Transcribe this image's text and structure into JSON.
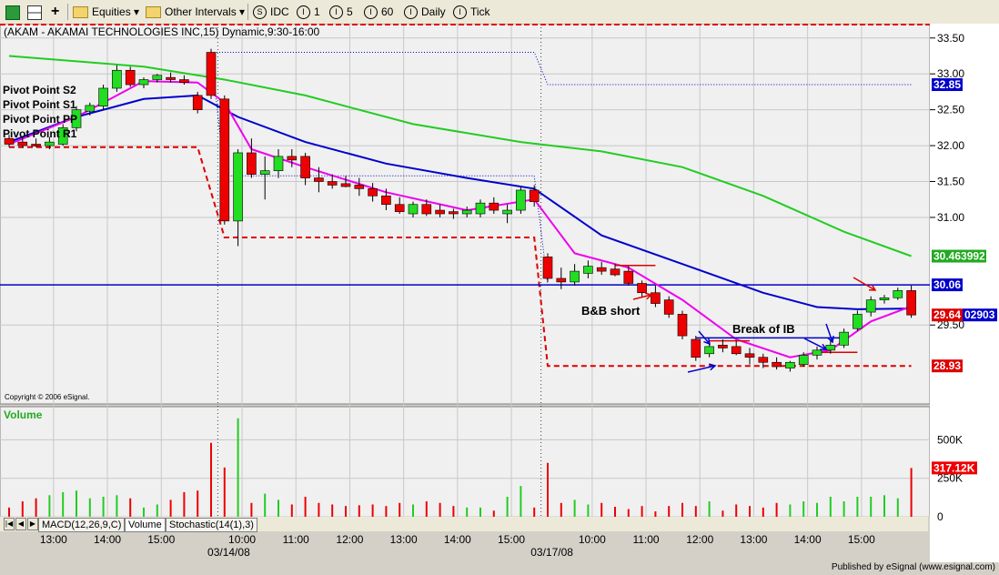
{
  "toolbar": {
    "equities_label": "Equities",
    "intervals_label": "Other Intervals",
    "idc_label": "IDC",
    "i1_label": "1",
    "i5_label": "5",
    "i60_label": "60",
    "daily_label": "Daily",
    "tick_label": "Tick",
    "colors": {
      "bg": "#ece9d8"
    }
  },
  "chart_header": "(AKAM - AKAMAI TECHNOLOGIES INC,15) Dynamic,9:30-16:00",
  "copyright": "Copyright © 2006 eSignal.",
  "published_by": "Published by eSignal (www.esignal.com)",
  "pivot_labels": [
    "Pivot Point S2",
    "Pivot Point S1",
    "Pivot Point PP",
    "Pivot Point R1"
  ],
  "annotations": {
    "bb_short": "B&B short",
    "break_ib": "Break of IB"
  },
  "volume_label": "Volume",
  "tabs": [
    "MACD(12,26,9,C)",
    "Volume",
    "Stochastic(14(1),3)"
  ],
  "chart_data": {
    "type": "candlestick",
    "symbol": "AKAM",
    "interval": "15",
    "price_axis": {
      "ylim": [
        28.4,
        33.7
      ],
      "ticks": [
        "33.50",
        "33.00",
        "32.50",
        "32.00",
        "31.50",
        "31.00",
        "29.50"
      ]
    },
    "price_labels": [
      {
        "text": "32.85",
        "value": 32.85,
        "color": "#0000cc"
      },
      {
        "text": "30.463992",
        "value": 30.46,
        "color": "#22aa22"
      },
      {
        "text": "30.06",
        "value": 30.06,
        "color": "#0000cc"
      },
      {
        "text": "29.64",
        "value": 29.64,
        "color": "#dd0000"
      },
      {
        "text": "02903",
        "value": 29.64,
        "color": "#0000cc"
      },
      {
        "text": "28.93",
        "value": 28.93,
        "color": "#dd0000"
      }
    ],
    "volume_axis": {
      "ylim": [
        0,
        650
      ],
      "ticks": [
        "500K",
        "250K",
        "0"
      ],
      "last_label": "317.12K"
    },
    "x_ticks": [
      "13:00",
      "14:00",
      "15:00",
      "10:00",
      "11:00",
      "12:00",
      "13:00",
      "14:00",
      "15:00",
      "10:00",
      "11:00",
      "12:00",
      "13:00",
      "14:00",
      "15:00"
    ],
    "date_labels": [
      "03/14/08",
      "03/17/08"
    ],
    "candles": [
      {
        "o": 32.1,
        "h": 32.15,
        "l": 31.98,
        "c": 32.02
      },
      {
        "o": 32.05,
        "h": 32.12,
        "l": 31.97,
        "c": 32.0
      },
      {
        "o": 32.02,
        "h": 32.1,
        "l": 31.98,
        "c": 32.0
      },
      {
        "o": 32.0,
        "h": 32.12,
        "l": 31.95,
        "c": 32.05
      },
      {
        "o": 32.02,
        "h": 32.3,
        "l": 32.0,
        "c": 32.25
      },
      {
        "o": 32.25,
        "h": 32.55,
        "l": 32.2,
        "c": 32.5
      },
      {
        "o": 32.48,
        "h": 32.6,
        "l": 32.42,
        "c": 32.56
      },
      {
        "o": 32.55,
        "h": 32.85,
        "l": 32.5,
        "c": 32.8
      },
      {
        "o": 32.8,
        "h": 33.12,
        "l": 32.75,
        "c": 33.05
      },
      {
        "o": 33.05,
        "h": 33.1,
        "l": 32.82,
        "c": 32.85
      },
      {
        "o": 32.85,
        "h": 32.95,
        "l": 32.8,
        "c": 32.92
      },
      {
        "o": 32.92,
        "h": 33.0,
        "l": 32.88,
        "c": 32.98
      },
      {
        "o": 32.95,
        "h": 33.02,
        "l": 32.88,
        "c": 32.92
      },
      {
        "o": 32.92,
        "h": 32.98,
        "l": 32.85,
        "c": 32.88
      },
      {
        "o": 32.7,
        "h": 32.75,
        "l": 32.45,
        "c": 32.5
      },
      {
        "o": 33.3,
        "h": 33.35,
        "l": 32.65,
        "c": 32.7
      },
      {
        "o": 32.65,
        "h": 32.7,
        "l": 30.9,
        "c": 30.95
      },
      {
        "o": 30.95,
        "h": 31.95,
        "l": 30.6,
        "c": 31.9
      },
      {
        "o": 31.9,
        "h": 32.1,
        "l": 31.55,
        "c": 31.6
      },
      {
        "o": 31.6,
        "h": 31.85,
        "l": 31.25,
        "c": 31.65
      },
      {
        "o": 31.65,
        "h": 31.95,
        "l": 31.55,
        "c": 31.85
      },
      {
        "o": 31.85,
        "h": 31.95,
        "l": 31.7,
        "c": 31.8
      },
      {
        "o": 31.85,
        "h": 31.9,
        "l": 31.45,
        "c": 31.55
      },
      {
        "o": 31.55,
        "h": 31.7,
        "l": 31.35,
        "c": 31.5
      },
      {
        "o": 31.5,
        "h": 31.6,
        "l": 31.4,
        "c": 31.45
      },
      {
        "o": 31.47,
        "h": 31.58,
        "l": 31.42,
        "c": 31.43
      },
      {
        "o": 31.45,
        "h": 31.55,
        "l": 31.3,
        "c": 31.4
      },
      {
        "o": 31.4,
        "h": 31.48,
        "l": 31.22,
        "c": 31.3
      },
      {
        "o": 31.3,
        "h": 31.4,
        "l": 31.1,
        "c": 31.18
      },
      {
        "o": 31.18,
        "h": 31.28,
        "l": 31.05,
        "c": 31.08
      },
      {
        "o": 31.05,
        "h": 31.22,
        "l": 31.0,
        "c": 31.18
      },
      {
        "o": 31.18,
        "h": 31.25,
        "l": 31.02,
        "c": 31.05
      },
      {
        "o": 31.1,
        "h": 31.18,
        "l": 31.0,
        "c": 31.05
      },
      {
        "o": 31.08,
        "h": 31.12,
        "l": 30.98,
        "c": 31.05
      },
      {
        "o": 31.05,
        "h": 31.15,
        "l": 31.0,
        "c": 31.1
      },
      {
        "o": 31.05,
        "h": 31.25,
        "l": 31.0,
        "c": 31.2
      },
      {
        "o": 31.2,
        "h": 31.28,
        "l": 31.05,
        "c": 31.1
      },
      {
        "o": 31.05,
        "h": 31.18,
        "l": 30.92,
        "c": 31.1
      },
      {
        "o": 31.1,
        "h": 31.42,
        "l": 31.05,
        "c": 31.38
      },
      {
        "o": 31.38,
        "h": 31.45,
        "l": 31.15,
        "c": 31.22
      },
      {
        "o": 30.45,
        "h": 30.5,
        "l": 30.1,
        "c": 30.15
      },
      {
        "o": 30.15,
        "h": 30.3,
        "l": 30.0,
        "c": 30.1
      },
      {
        "o": 30.1,
        "h": 30.35,
        "l": 30.05,
        "c": 30.25
      },
      {
        "o": 30.22,
        "h": 30.4,
        "l": 30.15,
        "c": 30.32
      },
      {
        "o": 30.3,
        "h": 30.38,
        "l": 30.2,
        "c": 30.25
      },
      {
        "o": 30.28,
        "h": 30.35,
        "l": 30.18,
        "c": 30.2
      },
      {
        "o": 30.25,
        "h": 30.32,
        "l": 30.05,
        "c": 30.08
      },
      {
        "o": 30.08,
        "h": 30.12,
        "l": 29.88,
        "c": 29.95
      },
      {
        "o": 29.95,
        "h": 30.05,
        "l": 29.75,
        "c": 29.8
      },
      {
        "o": 29.85,
        "h": 29.9,
        "l": 29.6,
        "c": 29.65
      },
      {
        "o": 29.65,
        "h": 29.7,
        "l": 29.3,
        "c": 29.35
      },
      {
        "o": 29.3,
        "h": 29.35,
        "l": 29.0,
        "c": 29.05
      },
      {
        "o": 29.1,
        "h": 29.25,
        "l": 29.05,
        "c": 29.2
      },
      {
        "o": 29.22,
        "h": 29.3,
        "l": 29.12,
        "c": 29.18
      },
      {
        "o": 29.2,
        "h": 29.28,
        "l": 29.08,
        "c": 29.1
      },
      {
        "o": 29.1,
        "h": 29.18,
        "l": 28.95,
        "c": 29.05
      },
      {
        "o": 29.05,
        "h": 29.1,
        "l": 28.9,
        "c": 28.98
      },
      {
        "o": 28.98,
        "h": 29.05,
        "l": 28.88,
        "c": 28.92
      },
      {
        "o": 28.9,
        "h": 29.0,
        "l": 28.85,
        "c": 28.98
      },
      {
        "o": 28.95,
        "h": 29.12,
        "l": 28.92,
        "c": 29.08
      },
      {
        "o": 29.08,
        "h": 29.2,
        "l": 29.02,
        "c": 29.15
      },
      {
        "o": 29.15,
        "h": 29.3,
        "l": 29.1,
        "c": 29.22
      },
      {
        "o": 29.22,
        "h": 29.45,
        "l": 29.18,
        "c": 29.4
      },
      {
        "o": 29.45,
        "h": 29.7,
        "l": 29.42,
        "c": 29.65
      },
      {
        "o": 29.68,
        "h": 29.9,
        "l": 29.62,
        "c": 29.85
      },
      {
        "o": 29.85,
        "h": 29.92,
        "l": 29.8,
        "c": 29.88
      },
      {
        "o": 29.88,
        "h": 30.02,
        "l": 29.85,
        "c": 29.98
      },
      {
        "o": 29.98,
        "h": 30.05,
        "l": 29.6,
        "c": 29.64
      }
    ],
    "volume": [
      60,
      100,
      120,
      140,
      160,
      170,
      120,
      130,
      140,
      120,
      60,
      80,
      110,
      160,
      170,
      480,
      320,
      640,
      90,
      150,
      110,
      80,
      130,
      90,
      80,
      70,
      75,
      80,
      70,
      90,
      80,
      100,
      90,
      70,
      60,
      60,
      40,
      130,
      200,
      60,
      350,
      90,
      110,
      80,
      90,
      65,
      50,
      70,
      35,
      70,
      90,
      70,
      100,
      40,
      80,
      70,
      60,
      90,
      80,
      100,
      90,
      130,
      100,
      130,
      130,
      140,
      120,
      317
    ],
    "series": [
      {
        "name": "Pivot Point S2",
        "style": "dashed",
        "color": "#dd0000"
      },
      {
        "name": "Pivot Point S1",
        "style": "solid",
        "color": "#0000cc"
      },
      {
        "name": "Pivot Point PP",
        "style": "dotted",
        "color": "#0000cc"
      },
      {
        "name": "Pivot Point R1",
        "style": "solid",
        "color": "#22aa22"
      }
    ],
    "pivot_s2": [
      [
        0,
        31.98
      ],
      [
        14,
        31.98
      ],
      [
        16,
        30.72
      ],
      [
        39,
        30.72
      ],
      [
        40,
        28.93
      ],
      [
        67,
        28.93
      ]
    ],
    "pp_dotted": [
      [
        15,
        33.3
      ],
      [
        16,
        31.58
      ],
      [
        39,
        31.58
      ],
      [
        40,
        30.06
      ],
      [
        67,
        30.06
      ]
    ],
    "r1_dotted": [
      [
        15,
        33.3
      ],
      [
        39,
        33.3
      ],
      [
        40,
        32.85
      ],
      [
        67,
        32.85
      ]
    ],
    "ib_line": [
      [
        51,
        29.32
      ],
      [
        62,
        29.32
      ]
    ],
    "ma_blue": [
      [
        0,
        32.05
      ],
      [
        5,
        32.4
      ],
      [
        10,
        32.65
      ],
      [
        14,
        32.7
      ],
      [
        17,
        32.4
      ],
      [
        22,
        32.05
      ],
      [
        28,
        31.75
      ],
      [
        34,
        31.55
      ],
      [
        39,
        31.4
      ],
      [
        44,
        30.75
      ],
      [
        50,
        30.35
      ],
      [
        56,
        29.95
      ],
      [
        60,
        29.75
      ],
      [
        63,
        29.72
      ],
      [
        67,
        29.73
      ]
    ],
    "ma_magenta": [
      [
        0,
        32.02
      ],
      [
        5,
        32.4
      ],
      [
        10,
        32.9
      ],
      [
        14,
        32.88
      ],
      [
        16,
        32.6
      ],
      [
        18,
        31.95
      ],
      [
        22,
        31.7
      ],
      [
        28,
        31.35
      ],
      [
        34,
        31.1
      ],
      [
        39,
        31.25
      ],
      [
        42,
        30.5
      ],
      [
        46,
        30.3
      ],
      [
        50,
        29.85
      ],
      [
        54,
        29.3
      ],
      [
        58,
        29.05
      ],
      [
        61,
        29.15
      ],
      [
        64,
        29.55
      ],
      [
        67,
        29.76
      ]
    ],
    "ma_green": [
      [
        0,
        33.25
      ],
      [
        10,
        33.1
      ],
      [
        16,
        32.92
      ],
      [
        22,
        32.7
      ],
      [
        30,
        32.3
      ],
      [
        38,
        32.05
      ],
      [
        44,
        31.92
      ],
      [
        50,
        31.7
      ],
      [
        56,
        31.3
      ],
      [
        62,
        30.8
      ],
      [
        67,
        30.46
      ]
    ]
  }
}
